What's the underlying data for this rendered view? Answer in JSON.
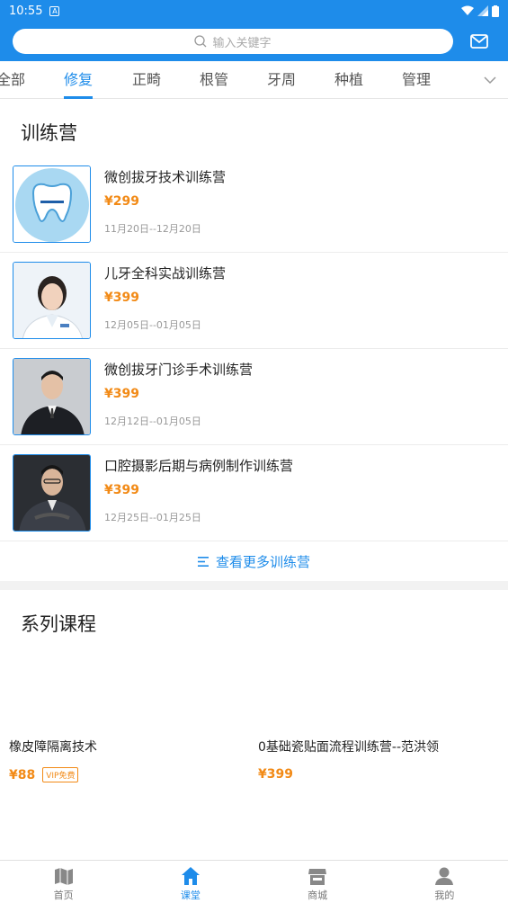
{
  "status": {
    "time": "10:55"
  },
  "search": {
    "placeholder": "输入关键字"
  },
  "tabs": [
    {
      "label": "全部"
    },
    {
      "label": "修复"
    },
    {
      "label": "正畸"
    },
    {
      "label": "根管"
    },
    {
      "label": "牙周"
    },
    {
      "label": "种植"
    },
    {
      "label": "管理"
    }
  ],
  "camp": {
    "title": "训练营",
    "items": [
      {
        "title": "微创拔牙技术训练营",
        "price": "¥299",
        "date": "11月20日--12月20日",
        "image": "tooth-logo"
      },
      {
        "title": "儿牙全科实战训练营",
        "price": "¥399",
        "date": "12月05日--01月05日",
        "image": "female-doctor-photo"
      },
      {
        "title": "微创拔牙门诊手术训练营",
        "price": "¥399",
        "date": "12月12日--01月05日",
        "image": "male-doctor-photo"
      },
      {
        "title": "口腔摄影后期与病例制作训练营",
        "price": "¥399",
        "date": "12月25日--01月25日",
        "image": "male-doctor-photo-2"
      }
    ],
    "more_label": "查看更多训练营"
  },
  "series": {
    "title": "系列课程",
    "courses": [
      {
        "name": "橡皮障隔离技术",
        "price": "¥88",
        "badge": "VIP免费"
      },
      {
        "name": "0基础瓷贴面流程训练营--范洪领",
        "price": "¥399"
      }
    ]
  },
  "bottom_nav": [
    {
      "label": "首页",
      "icon": "map-icon"
    },
    {
      "label": "课堂",
      "icon": "home-icon"
    },
    {
      "label": "商城",
      "icon": "store-icon"
    },
    {
      "label": "我的",
      "icon": "person-icon"
    }
  ],
  "colors": {
    "primary": "#1e8cea",
    "price": "#f28a16"
  }
}
